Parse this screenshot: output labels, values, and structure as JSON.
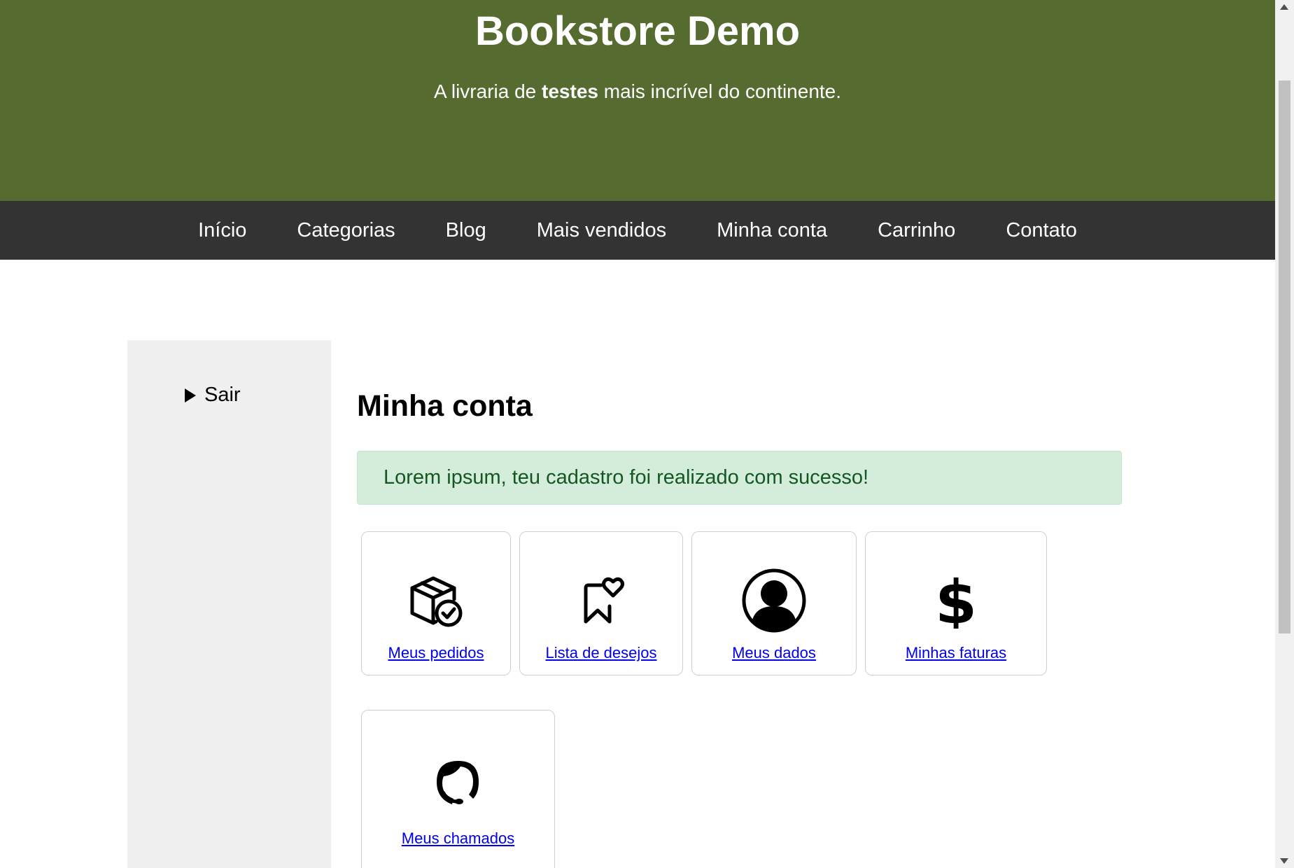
{
  "header": {
    "title": "Bookstore Demo",
    "tagline_prefix": "A livraria de ",
    "tagline_bold": "testes",
    "tagline_suffix": " mais incrível do continente.",
    "background": "#556b2f"
  },
  "nav": {
    "items": [
      "Início",
      "Categorias",
      "Blog",
      "Mais vendidos",
      "Minha conta",
      "Carrinho",
      "Contato"
    ],
    "background": "#333333"
  },
  "sidebar": {
    "logout_label": "Sair"
  },
  "main": {
    "heading": "Minha conta",
    "alert": "Lorem ipsum, teu cadastro foi realizado com sucesso!",
    "cards": [
      {
        "label": "Meus pedidos",
        "icon": "package-check-icon"
      },
      {
        "label": "Lista de desejos",
        "icon": "bookmark-heart-icon"
      },
      {
        "label": "Meus dados",
        "icon": "user-circle-icon"
      },
      {
        "label": "Minhas faturas",
        "icon": "dollar-icon"
      },
      {
        "label": "Meus chamados",
        "icon": "headset-icon"
      }
    ]
  }
}
